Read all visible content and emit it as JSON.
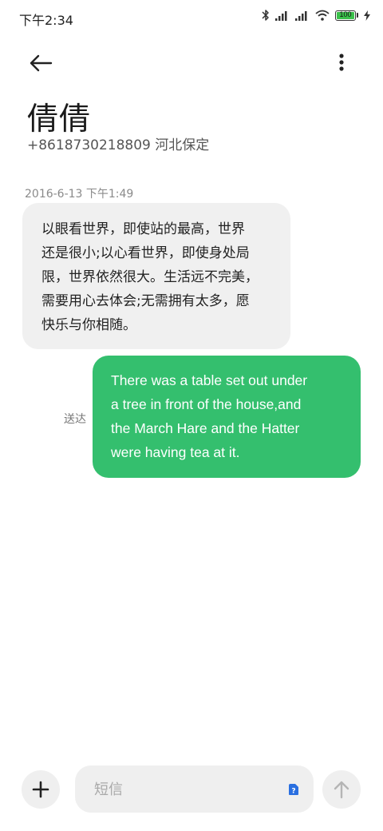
{
  "status_bar": {
    "time": "下午2:34",
    "battery": "100",
    "battery_level": 1.0,
    "icons": [
      "bluetooth-icon",
      "signal-icon",
      "signal-icon",
      "wifi-icon",
      "battery-icon",
      "charging-icon"
    ]
  },
  "header": {
    "contact_name": "倩倩",
    "contact_detail": "+8618730218809 河北保定"
  },
  "conversation": {
    "timestamp": "2016-6-13 下午1:49",
    "incoming": [
      "以眼看世界，即使站的最高，世界",
      "还是很小;以心看世界，即使身处局",
      "限，世界依然很大。生活远不完美，",
      "需要用心去体会;无需拥有太多，愿",
      "快乐与你相随。"
    ],
    "outgoing": [
      "There was a table set out under",
      "a tree in front of the house,and",
      "the March Hare and the Hatter",
      "were having tea at it."
    ],
    "outgoing_status": "送达"
  },
  "composer": {
    "placeholder": "短信",
    "sim_badge": "?"
  },
  "colors": {
    "outgoing_bubble": "#34bf6e",
    "incoming_bubble": "#f0f0f0",
    "composer_bg": "#efefef",
    "sim_badge": "#2a6fe0"
  }
}
